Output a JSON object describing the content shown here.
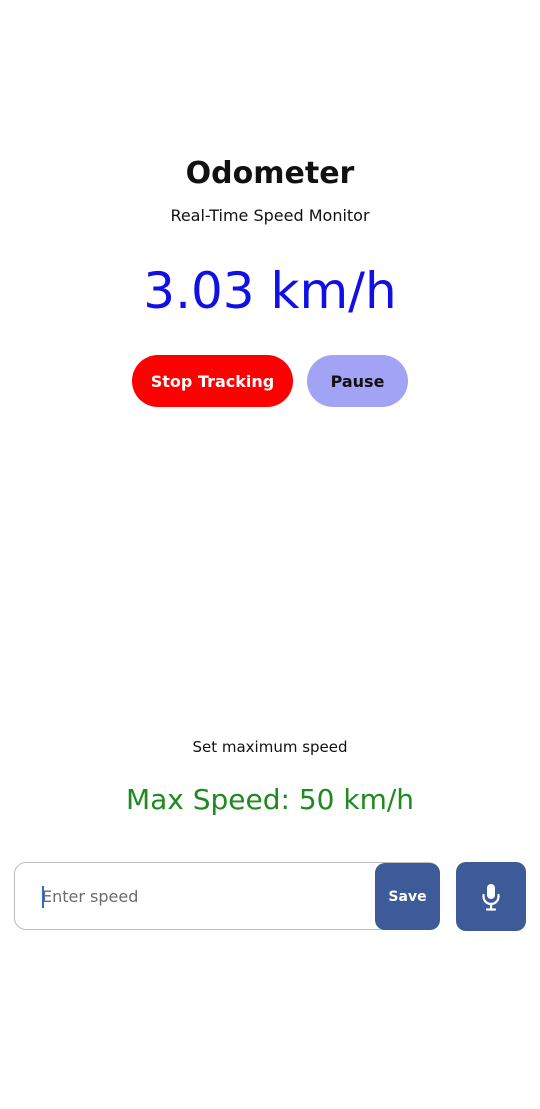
{
  "header": {
    "title": "Odometer",
    "subtitle": "Real-Time Speed Monitor"
  },
  "speed": {
    "display": "3.03 km/h"
  },
  "controls": {
    "stop_label": "Stop Tracking",
    "pause_label": "Pause"
  },
  "max_speed": {
    "set_label": "Set maximum speed",
    "display": "Max Speed: 50 km/h",
    "input_placeholder": "Enter speed",
    "save_label": "Save",
    "mic_icon": "microphone-icon"
  },
  "colors": {
    "speed": "#1010e6",
    "stop_button": "#ff0000",
    "pause_button": "#a3a3f5",
    "max_speed_text": "#1f8a1f",
    "action_button": "#3c5b98"
  }
}
